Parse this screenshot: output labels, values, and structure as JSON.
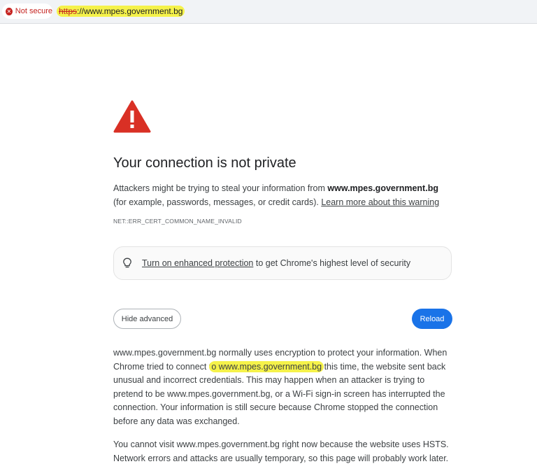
{
  "address_bar": {
    "security_chip": "Not secure",
    "security_icon": "x-circle-icon",
    "url_scheme": "https",
    "url_rest": "://www.mpes.government.bg"
  },
  "warning": {
    "icon": "warning-triangle-icon",
    "icon_color": "#d93025",
    "title": "Your connection is not private",
    "p1_before": "Attackers might be trying to steal your information from ",
    "p1_domain": "www.mpes.government.bg",
    "p1_after": " (for example, passwords, messages, or credit cards). ",
    "learn_more": "Learn more about this warning",
    "error_code": "NET::ERR_CERT_COMMON_NAME_INVALID"
  },
  "protection": {
    "icon": "lightbulb-icon",
    "link": "Turn on enhanced protection",
    "text": " to get Chrome's highest level of security"
  },
  "buttons": {
    "hide_advanced": "Hide advanced",
    "reload": "Reload",
    "accent": "#1a73e8"
  },
  "advanced": {
    "p2_a": "www.mpes.government.bg normally uses encryption to protect your information. When Chrome tried to connect t",
    "p2_b": "o ",
    "p2_domain": "www.mpes.government.bg",
    "p2_c": " this time, the website sent back unusual and incorrect credentials. This may happen when an attacker is trying to pretend to be www.mpes.government.bg, or a Wi-Fi sign-in screen has interrupted the connection. Your information is still secure because Chrome stopped the connection before any data was exchanged.",
    "p3": "You cannot visit www.mpes.government.bg right now because the website uses HSTS. Network errors and attacks are usually temporary, so this page will probably work later."
  },
  "highlight_color": "#f5f24a"
}
